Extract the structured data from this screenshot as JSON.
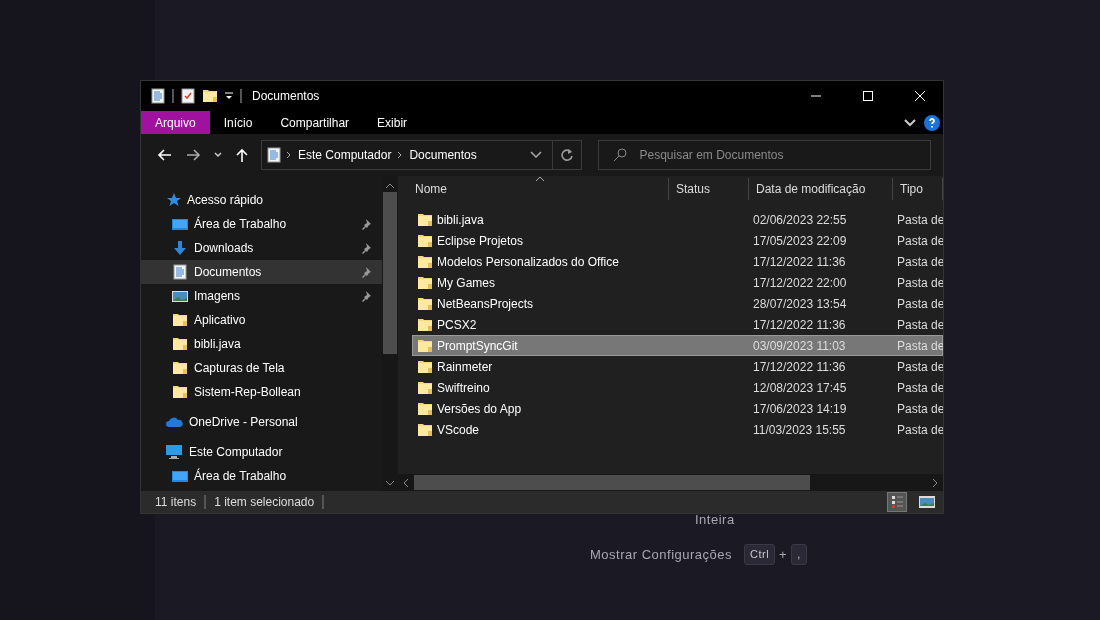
{
  "window": {
    "title": "Documentos"
  },
  "ribbon_tabs": [
    {
      "label": "Arquivo",
      "selected": true
    },
    {
      "label": "Início",
      "selected": false
    },
    {
      "label": "Compartilhar",
      "selected": false
    },
    {
      "label": "Exibir",
      "selected": false
    }
  ],
  "address": {
    "crumbs": [
      "Este Computador",
      "Documentos"
    ]
  },
  "search": {
    "placeholder": "Pesquisar em Documentos"
  },
  "nav": [
    {
      "label": "Acesso rápido",
      "kind": "quick",
      "selected": false,
      "children": [
        {
          "label": "Área de Trabalho",
          "kind": "desktop",
          "pinned": true,
          "selected": false
        },
        {
          "label": "Downloads",
          "kind": "download",
          "pinned": true,
          "selected": false
        },
        {
          "label": "Documentos",
          "kind": "documents",
          "pinned": true,
          "selected": true
        },
        {
          "label": "Imagens",
          "kind": "pictures",
          "pinned": true,
          "selected": false
        },
        {
          "label": "Aplicativo",
          "kind": "folder",
          "pinned": false,
          "selected": false
        },
        {
          "label": "bibli.java",
          "kind": "folder",
          "pinned": false,
          "selected": false
        },
        {
          "label": "Capturas de Tela",
          "kind": "folder",
          "pinned": false,
          "selected": false
        },
        {
          "label": "Sistem-Rep-Bollean",
          "kind": "folder",
          "pinned": false,
          "selected": false
        }
      ]
    },
    {
      "label": "OneDrive - Personal",
      "kind": "cloud",
      "selected": false
    },
    {
      "label": "Este Computador",
      "kind": "pc",
      "selected": false,
      "children": [
        {
          "label": "Área de Trabalho",
          "kind": "desktop",
          "pinned": false,
          "selected": false
        }
      ]
    }
  ],
  "columns": [
    "Nome",
    "Status",
    "Data de modificação",
    "Tipo"
  ],
  "rows": [
    {
      "name": "bibli.java",
      "modified": "02/06/2023 22:55",
      "type": "Pasta de",
      "selected": false
    },
    {
      "name": "Eclipse Projetos",
      "modified": "17/05/2023 22:09",
      "type": "Pasta de",
      "selected": false
    },
    {
      "name": "Modelos Personalizados do Office",
      "modified": "17/12/2022 11:36",
      "type": "Pasta de",
      "selected": false
    },
    {
      "name": "My Games",
      "modified": "17/12/2022 22:00",
      "type": "Pasta de",
      "selected": false
    },
    {
      "name": "NetBeansProjects",
      "modified": "28/07/2023 13:54",
      "type": "Pasta de",
      "selected": false
    },
    {
      "name": "PCSX2",
      "modified": "17/12/2022 11:36",
      "type": "Pasta de",
      "selected": false
    },
    {
      "name": "PromptSyncGit",
      "modified": "03/09/2023 11:03",
      "type": "Pasta de",
      "selected": true
    },
    {
      "name": "Rainmeter",
      "modified": "17/12/2022 11:36",
      "type": "Pasta de",
      "selected": false
    },
    {
      "name": "Swiftreino",
      "modified": "12/08/2023 17:45",
      "type": "Pasta de",
      "selected": false
    },
    {
      "name": "Versões do App",
      "modified": "17/06/2023 14:19",
      "type": "Pasta de",
      "selected": false
    },
    {
      "name": "VScode",
      "modified": "11/03/2023 15:55",
      "type": "Pasta de",
      "selected": false
    }
  ],
  "status_bar": {
    "count": "11 itens",
    "selection": "1 item selecionado"
  },
  "background": {
    "partial_label": "Inteira",
    "shortcut": {
      "label": "Mostrar Configurações",
      "keys": [
        "Ctrl",
        ","
      ],
      "joiner": "+"
    }
  }
}
